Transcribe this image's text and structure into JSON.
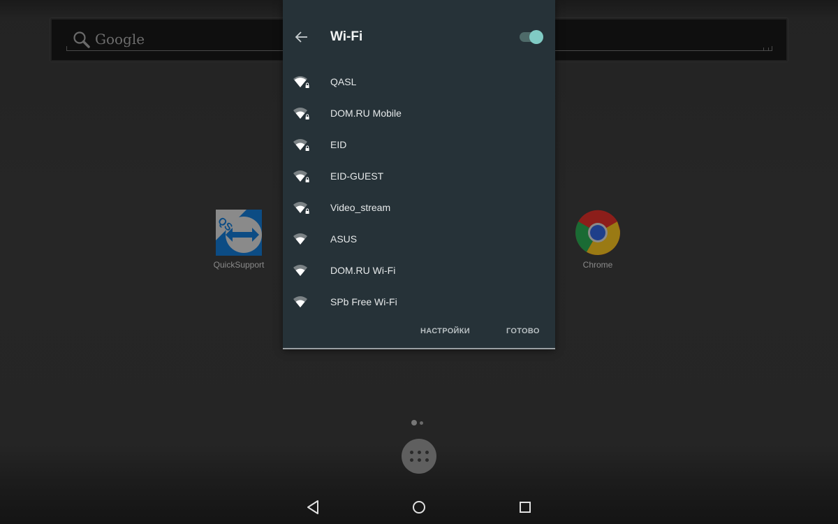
{
  "home": {
    "search": {
      "placeholder": "Google",
      "icon": "search-icon"
    },
    "apps": [
      {
        "label": "QuickSupport",
        "icon": "quicksupport-icon"
      },
      {
        "label": "Chrome",
        "icon": "chrome-icon"
      }
    ],
    "page_indicator": {
      "pages": 2,
      "current": 1
    },
    "app_drawer_icon": "apps-grid-icon"
  },
  "navigation": {
    "back": "back-icon",
    "home": "home-icon",
    "recents": "recents-icon"
  },
  "wifi_dialog": {
    "title": "Wi-Fi",
    "enabled": true,
    "accent_color": "#80cbc4",
    "networks": [
      {
        "name": "QASL",
        "secured": true,
        "signal": 3
      },
      {
        "name": "DOM.RU Mobile",
        "secured": true,
        "signal": 2
      },
      {
        "name": "EID",
        "secured": true,
        "signal": 2
      },
      {
        "name": "EID-GUEST",
        "secured": true,
        "signal": 2
      },
      {
        "name": "Video_stream",
        "secured": true,
        "signal": 2
      },
      {
        "name": "ASUS",
        "secured": false,
        "signal": 2
      },
      {
        "name": "DOM.RU Wi-Fi",
        "secured": false,
        "signal": 2
      },
      {
        "name": "SPb Free Wi-Fi",
        "secured": false,
        "signal": 2
      }
    ],
    "actions": {
      "settings": "НАСТРОЙКИ",
      "done": "ГОТОВО"
    }
  }
}
